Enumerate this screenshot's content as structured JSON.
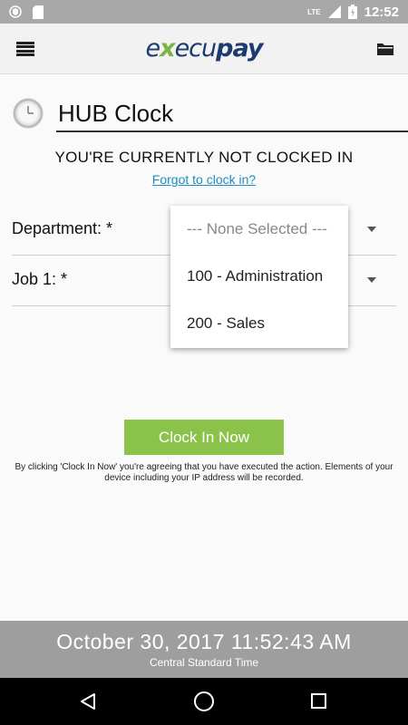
{
  "status_bar": {
    "time": "12:52",
    "network": "LTE",
    "icons": [
      "shield-icon",
      "sd-card-icon",
      "signal-icon",
      "battery-charging-icon"
    ]
  },
  "app_bar": {
    "brand": {
      "e": "e",
      "x": "x",
      "ecu": "ecu",
      "pay": "pay"
    },
    "menu_icon": "hamburger-icon",
    "action_icon": "folder-icon"
  },
  "page": {
    "title": "HUB Clock",
    "status_message": "YOU'RE CURRENTLY NOT CLOCKED IN",
    "forgot_link": "Forgot to clock in?"
  },
  "form": {
    "department_label": "Department: *",
    "job_label": "Job 1: *"
  },
  "dropdown": {
    "options": [
      "--- None Selected ---",
      "100 - Administration",
      "200 - Sales"
    ]
  },
  "actions": {
    "clock_in_label": "Clock In Now",
    "disclaimer": "By clicking 'Clock In Now' you're agreeing that you have executed the action. Elements of your device including your IP address will be recorded."
  },
  "footer": {
    "datetime": "October 30, 2017 11:52:43 AM",
    "timezone": "Central Standard Time"
  },
  "colors": {
    "accent_green": "#8bc34a",
    "link_blue": "#1a8fc4",
    "brand_navy": "#1d3b6e",
    "footer_gray": "#9e9e9e"
  }
}
